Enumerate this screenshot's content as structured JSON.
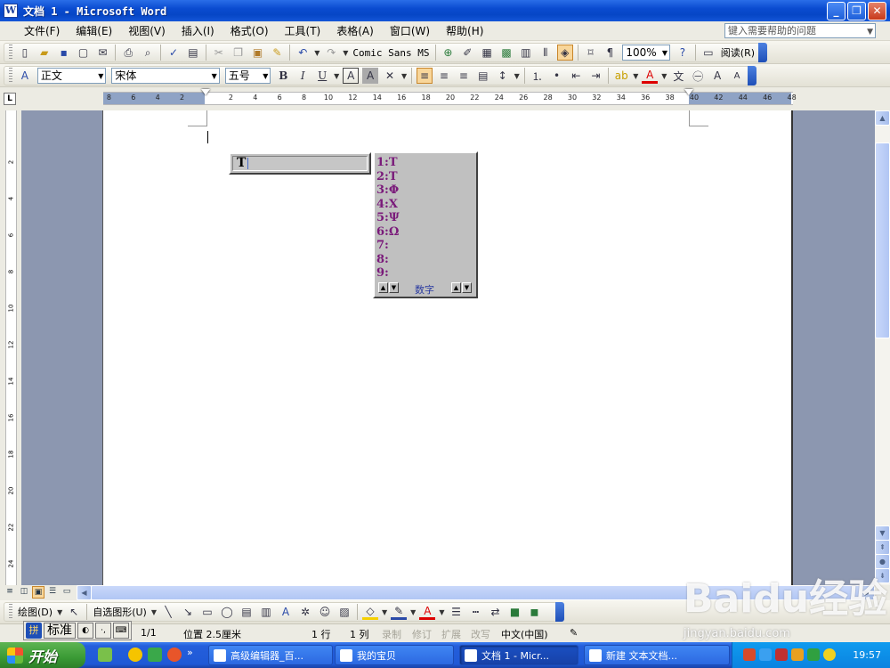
{
  "titlebar": {
    "title": "文档 1 - Microsoft Word",
    "minimize": "_",
    "restore": "❐",
    "close": "✕"
  },
  "menu": {
    "items": [
      "文件(F)",
      "编辑(E)",
      "视图(V)",
      "插入(I)",
      "格式(O)",
      "工具(T)",
      "表格(A)",
      "窗口(W)",
      "帮助(H)"
    ],
    "help_placeholder": "键入需要帮助的问题"
  },
  "toolbar_standard": {
    "font_preview": "Comic Sans MS",
    "zoom": "100%",
    "read_label": "阅读(R)"
  },
  "toolbar_format": {
    "style": "正文",
    "font": "宋体",
    "size": "五号",
    "bold": "B",
    "italic": "I",
    "underline": "U"
  },
  "ruler": {
    "h_numbers": [
      "8",
      "6",
      "4",
      "2",
      "2",
      "4",
      "6",
      "8",
      "10",
      "12",
      "14",
      "16",
      "18",
      "20",
      "22",
      "24",
      "26",
      "28",
      "30",
      "32",
      "34",
      "36",
      "38",
      "40",
      "42",
      "44",
      "46",
      "48"
    ],
    "v_numbers": [
      "2",
      "4",
      "6",
      "8",
      "10",
      "12",
      "14",
      "16",
      "18",
      "20",
      "22",
      "24"
    ]
  },
  "ime": {
    "composition": "T",
    "candidates": [
      "1:Τ",
      "2:Τ",
      "3:Φ",
      "4:Χ",
      "5:Ψ",
      "6:Ω",
      "7:",
      "8:",
      "9:"
    ],
    "mode": "数字",
    "bar_label": "标准"
  },
  "drawbar": {
    "draw": "绘图(D)",
    "autoshape": "自选图形(U)"
  },
  "status": {
    "page": "1/1",
    "position": "位置 2.5厘米",
    "line": "1 行",
    "col": "1 列",
    "rec": "录制",
    "trk": "修订",
    "ext": "扩展",
    "ovr": "改写",
    "lang": "中文(中国)"
  },
  "taskbar": {
    "start": "开始",
    "tasks": [
      "高级编辑器_百...",
      "我的宝贝",
      "文档 1 - Micr...",
      "新建 文本文档..."
    ],
    "clock": "19:57"
  },
  "watermark": {
    "brand": "Baidu经验",
    "url": "jingyan.baidu.com"
  }
}
